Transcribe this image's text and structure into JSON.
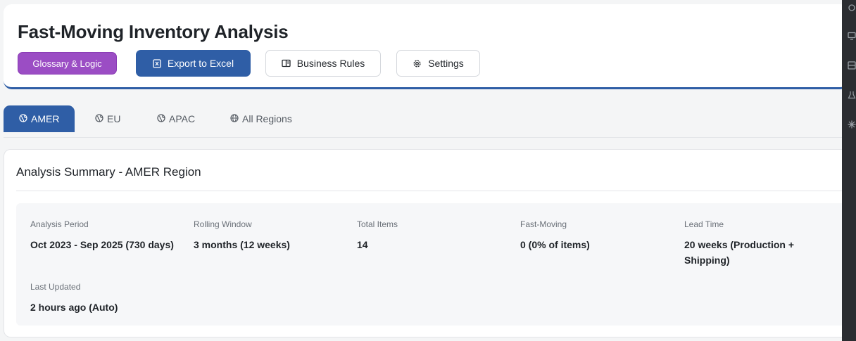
{
  "header": {
    "title": "Fast-Moving Inventory Analysis",
    "buttons": {
      "glossary": "Glossary & Logic",
      "export": "Export to Excel",
      "rules": "Business Rules",
      "settings": "Settings"
    }
  },
  "tabs": [
    {
      "label": "AMER",
      "active": true
    },
    {
      "label": "EU",
      "active": false
    },
    {
      "label": "APAC",
      "active": false
    },
    {
      "label": "All Regions",
      "active": false
    }
  ],
  "summary": {
    "title": "Analysis Summary - AMER Region",
    "stats": [
      {
        "label": "Analysis Period",
        "value": "Oct 2023 - Sep 2025 (730 days)"
      },
      {
        "label": "Rolling Window",
        "value": "3 months (12 weeks)"
      },
      {
        "label": "Total Items",
        "value": "14"
      },
      {
        "label": "Fast-Moving",
        "value": "0 (0% of items)"
      },
      {
        "label": "Lead Time",
        "value": "20 weeks (Production + Shipping)"
      },
      {
        "label": "Last Updated",
        "value": "2 hours ago (Auto)"
      }
    ]
  },
  "colors": {
    "accent": "#2f5ea6",
    "glossary": "#9b4dc4"
  }
}
